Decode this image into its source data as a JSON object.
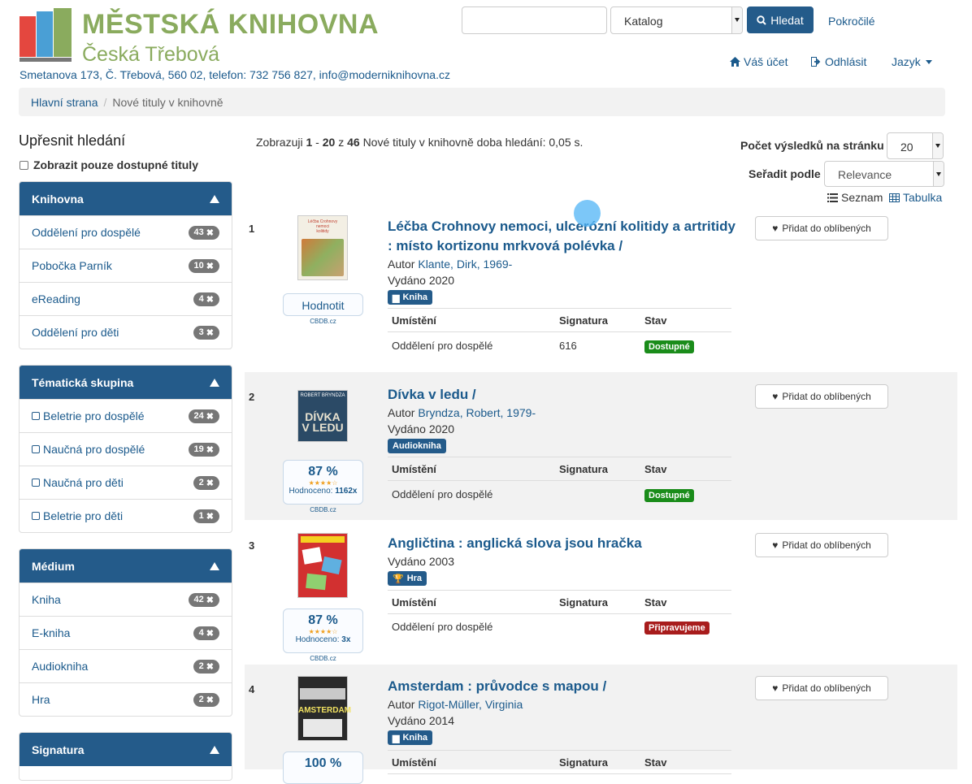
{
  "header": {
    "logo_title": "MĚSTSKÁ KNIHOVNA",
    "logo_subtitle": "Česká Třebová",
    "address": "Smetanova 173, Č. Třebová, 560 02, telefon: 732 756 827, info@moderniknihovna.cz",
    "search_value": "",
    "search_type": "Katalog",
    "search_button": "Hledat",
    "advanced_link": "Pokročilé",
    "account_link": "Váš účet",
    "logout_link": "Odhlásit",
    "language_menu": "Jazyk"
  },
  "breadcrumb": {
    "home": "Hlavní strana",
    "current": "Nové tituly v knihovně"
  },
  "sidebar": {
    "title": "Upřesnit hledání",
    "available_only": "Zobrazit pouze dostupné tituly",
    "facets": [
      {
        "title": "Knihovna",
        "items": [
          {
            "label": "Oddělení pro dospělé",
            "count": "43"
          },
          {
            "label": "Pobočka Parník",
            "count": "10"
          },
          {
            "label": "eReading",
            "count": "4"
          },
          {
            "label": "Oddělení pro děti",
            "count": "3"
          }
        ]
      },
      {
        "title": "Tématická skupina",
        "items": [
          {
            "label": "Beletrie pro dospělé",
            "count": "24"
          },
          {
            "label": "Naučná pro dospělé",
            "count": "19"
          },
          {
            "label": "Naučná pro děti",
            "count": "2"
          },
          {
            "label": "Beletrie pro děti",
            "count": "1"
          }
        ]
      },
      {
        "title": "Médium",
        "items": [
          {
            "label": "Kniha",
            "count": "42"
          },
          {
            "label": "E-kniha",
            "count": "4"
          },
          {
            "label": "Audiokniha",
            "count": "2"
          },
          {
            "label": "Hra",
            "count": "2"
          }
        ]
      },
      {
        "title": "Signatura",
        "items": []
      }
    ]
  },
  "results_header": {
    "summary_prefix": "Zobrazuji",
    "range_start": "1",
    "range_sep": "-",
    "range_end": "20",
    "of": "z",
    "total": "46",
    "summary_suffix": "Nové tituly v knihovně doba hledání: 0,05 s.",
    "per_page_label": "Počet výsledků na stránku",
    "per_page_value": "20",
    "sort_label": "Seřadit podle",
    "sort_value": "Relevance",
    "view_list": "Seznam",
    "view_table": "Tabulka"
  },
  "holdings_headers": {
    "location": "Umístění",
    "callnumber": "Signatura",
    "status": "Stav"
  },
  "favorite_label": "Přidat do oblíbených",
  "rating_source": "CBDB.cz",
  "rated_label": "Hodnoceno:",
  "results": [
    {
      "num": "1",
      "title_line1": "Léčba Crohnovy nemoci, ulcerózní kolitidy a artritidy",
      "title_line2": ": místo kortizonu mrkvová polévka /",
      "author_label": "Autor",
      "author": "Klante, Dirk, 1969-",
      "published": "Vydáno 2020",
      "format": "Kniha",
      "format_icon": "book-icon",
      "rating_button": "Hodnotit",
      "location": "Oddělení pro dospělé",
      "callnumber": "616",
      "status": "Dostupné",
      "cover_color": "#c9a070"
    },
    {
      "num": "2",
      "title_line1": "Dívka v ledu /",
      "author_label": "Autor",
      "author": "Bryndza, Robert, 1979-",
      "published": "Vydáno 2020",
      "format": "Audiokniha",
      "rating_pct": "87 %",
      "rated_count": "1162x",
      "location": "Oddělení pro dospělé",
      "callnumber": "",
      "status": "Dostupné",
      "cover_color": "#3f6a8a"
    },
    {
      "num": "3",
      "title_line1": "Angličtina : anglická slova jsou hračka",
      "published": "Vydáno 2003",
      "format": "Hra",
      "format_icon": "trophy-icon",
      "rating_pct": "87 %",
      "rated_count": "3x",
      "location": "Oddělení pro dospělé",
      "callnumber": "",
      "status": "Připravujeme",
      "cover_color": "#d23030"
    },
    {
      "num": "4",
      "title_line1": "Amsterdam : průvodce s mapou /",
      "author_label": "Autor",
      "author": "Rigot-Müller, Virginia",
      "published": "Vydáno 2014",
      "format": "Kniha",
      "format_icon": "book-icon",
      "rating_pct": "100 %"
    }
  ],
  "colors": {
    "accent": "#245b8a",
    "logo_green": "#8aab5e",
    "available": "#1a8c1a",
    "preparing": "#a81c1c"
  }
}
